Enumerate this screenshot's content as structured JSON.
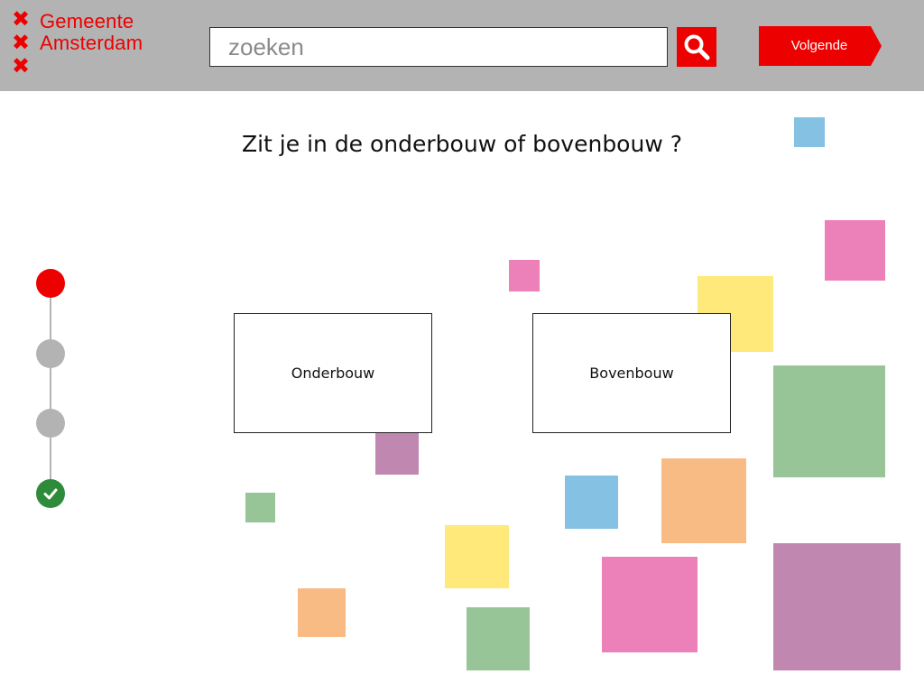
{
  "header": {
    "logo": {
      "line1": "Gemeente",
      "line2": "Amsterdam",
      "cross_glyph": "✖",
      "color": "#ec0000"
    },
    "search": {
      "placeholder": "zoeken",
      "value": "",
      "icon": "search-icon"
    },
    "next_button": {
      "label": "Volgende"
    }
  },
  "main": {
    "question": "Zit je in de onderbouw of bovenbouw ?",
    "options": [
      {
        "label": "Onderbouw"
      },
      {
        "label": "Bovenbouw"
      }
    ]
  },
  "stepper": {
    "steps": [
      {
        "state": "active",
        "color": "#ec0000"
      },
      {
        "state": "inactive",
        "color": "#b3b3b3"
      },
      {
        "state": "inactive",
        "color": "#b3b3b3"
      },
      {
        "state": "completed",
        "color": "#2e8b3a",
        "icon": "checkmark-icon"
      }
    ]
  },
  "colors": {
    "header_bg": "#b3b3b3",
    "brand_red": "#ec0000",
    "blue": "#85c1e3",
    "pink": "#ec80b8",
    "yellow": "#fee97a",
    "green": "#97c597",
    "purple": "#c088b0",
    "orange": "#f8bb84"
  }
}
